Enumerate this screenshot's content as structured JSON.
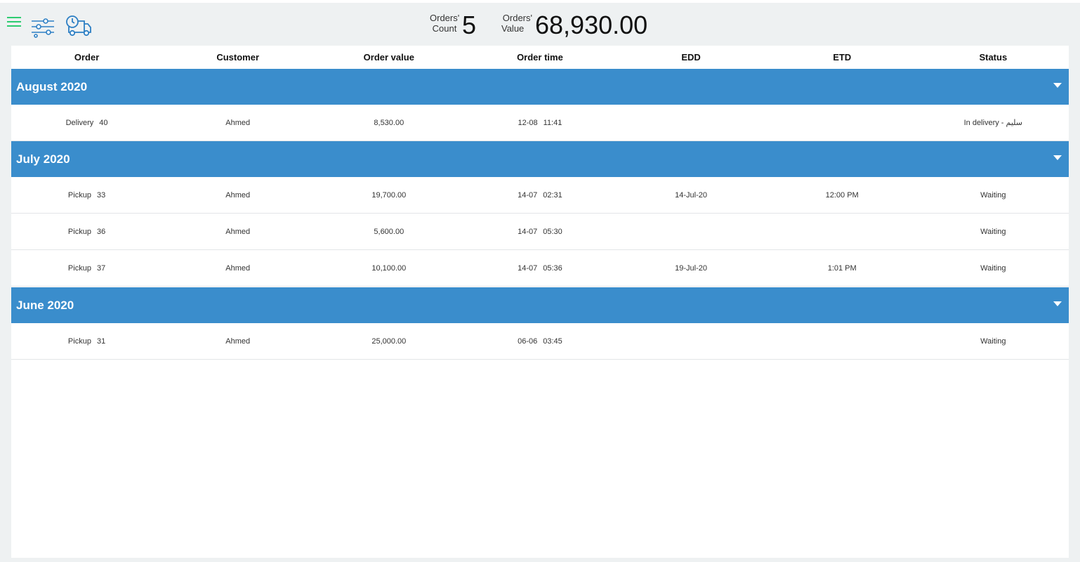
{
  "toolbar": {
    "icons": [
      "menu-icon",
      "filter-sliders-icon",
      "delivery-truck-clock-icon"
    ],
    "orders_count_label": "Orders' Count",
    "orders_count_label_line1": "Orders'",
    "orders_count_label_line2": "Count",
    "orders_count": "5",
    "orders_value_label_line1": "Orders'",
    "orders_value_label_line2": "Value",
    "orders_value": "68,930.00"
  },
  "colors": {
    "accent": "#3a8dcc",
    "menu_icon": "#2ecc71",
    "background": "#eef1f2"
  },
  "table": {
    "columns": [
      "Order",
      "Customer",
      "Order value",
      "Order time",
      "EDD",
      "ETD",
      "Status"
    ],
    "groups": [
      {
        "title": "August 2020",
        "rows": [
          {
            "order_type": "Delivery",
            "order_no": "40",
            "customer": "Ahmed",
            "value": "8,530.00",
            "date": "12-08",
            "time": "11:41",
            "edd": "",
            "etd": "",
            "status": "In delivery - سليم"
          }
        ]
      },
      {
        "title": "July 2020",
        "rows": [
          {
            "order_type": "Pickup",
            "order_no": "33",
            "customer": "Ahmed",
            "value": "19,700.00",
            "date": "14-07",
            "time": "02:31",
            "edd": "14-Jul-20",
            "etd": "12:00 PM",
            "status": "Waiting"
          },
          {
            "order_type": "Pickup",
            "order_no": "36",
            "customer": "Ahmed",
            "value": "5,600.00",
            "date": "14-07",
            "time": "05:30",
            "edd": "",
            "etd": "",
            "status": "Waiting"
          },
          {
            "order_type": "Pickup",
            "order_no": "37",
            "customer": "Ahmed",
            "value": "10,100.00",
            "date": "14-07",
            "time": "05:36",
            "edd": "19-Jul-20",
            "etd": "1:01 PM",
            "status": "Waiting"
          }
        ]
      },
      {
        "title": "June 2020",
        "rows": [
          {
            "order_type": "Pickup",
            "order_no": "31",
            "customer": "Ahmed",
            "value": "25,000.00",
            "date": "06-06",
            "time": "03:45",
            "edd": "",
            "etd": "",
            "status": "Waiting"
          }
        ]
      }
    ]
  }
}
